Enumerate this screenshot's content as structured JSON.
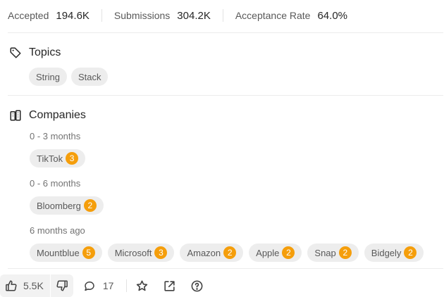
{
  "stats": {
    "accepted_label": "Accepted",
    "accepted_value": "194.6K",
    "submissions_label": "Submissions",
    "submissions_value": "304.2K",
    "rate_label": "Acceptance Rate",
    "rate_value": "64.0%"
  },
  "topics": {
    "title": "Topics",
    "icon": "tag-icon",
    "items": [
      "String",
      "Stack"
    ]
  },
  "companies": {
    "title": "Companies",
    "icon": "building-icon",
    "groups": [
      {
        "period": "0 - 3 months",
        "items": [
          {
            "name": "TikTok",
            "count": "3"
          }
        ]
      },
      {
        "period": "0 - 6 months",
        "items": [
          {
            "name": "Bloomberg",
            "count": "2"
          }
        ]
      },
      {
        "period": "6 months ago",
        "items": [
          {
            "name": "Mountblue",
            "count": "5"
          },
          {
            "name": "Microsoft",
            "count": "3"
          },
          {
            "name": "Amazon",
            "count": "2"
          },
          {
            "name": "Apple",
            "count": "2"
          },
          {
            "name": "Snap",
            "count": "2"
          },
          {
            "name": "Bidgely",
            "count": "2"
          }
        ]
      }
    ]
  },
  "footer": {
    "likes": "5.5K",
    "comments": "17",
    "like_icon": "thumbs-up-icon",
    "dislike_icon": "thumbs-down-icon",
    "comment_icon": "comment-icon",
    "star_icon": "star-icon",
    "share_icon": "share-icon",
    "help_icon": "help-icon"
  },
  "colors": {
    "badge": "#f59e0b",
    "tag_bg": "#ededed",
    "text": "#262626",
    "muted": "#595959"
  }
}
